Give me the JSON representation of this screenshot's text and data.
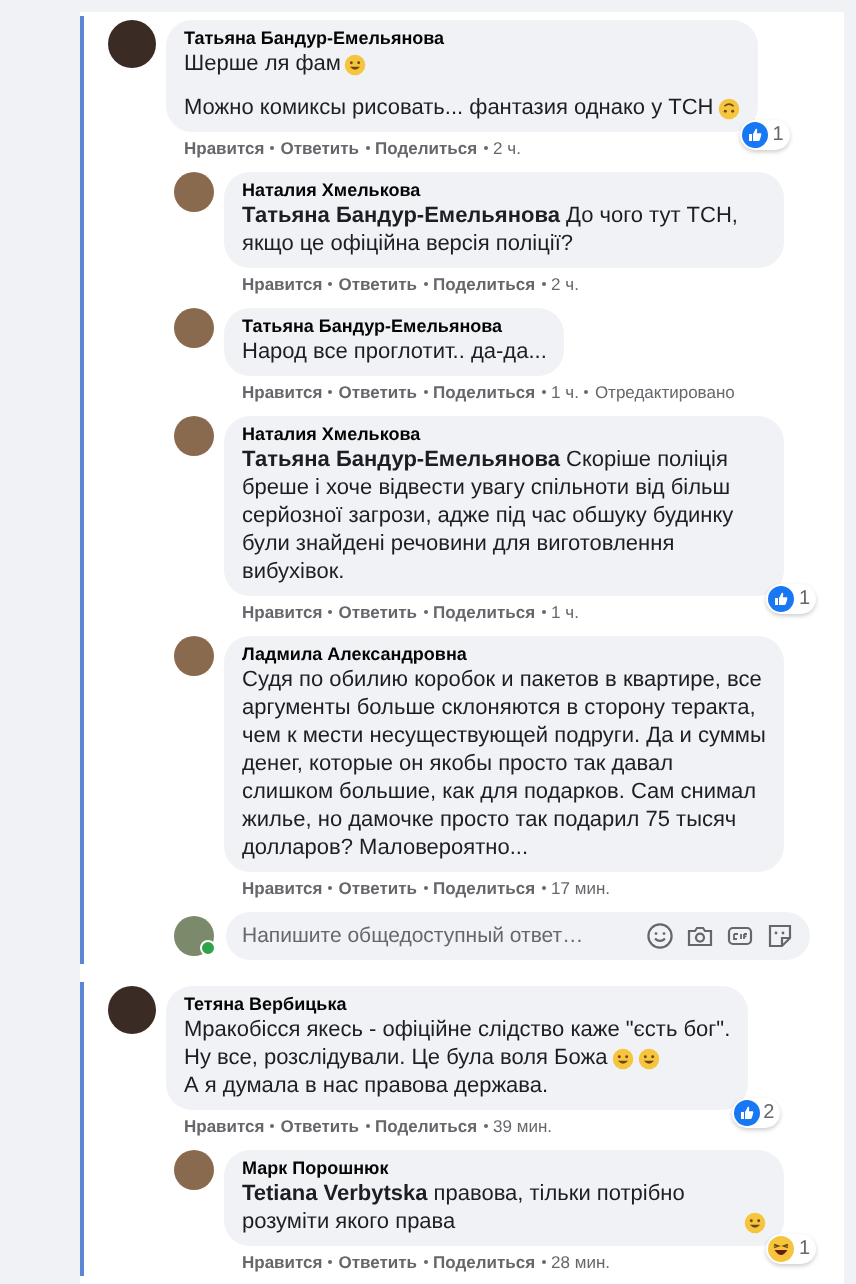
{
  "threads": [
    {
      "author": "Татьяна Бандур-Емельянова",
      "paragraphs": [
        [
          {
            "text": "Шерше ля фам",
            "emojis": [
              {
                "kind": "grin"
              }
            ]
          }
        ],
        [
          {
            "text": "Можно комиксы рисовать... фантазия однако у ТСН",
            "emojis": [
              {
                "kind": "upside-down"
              }
            ]
          }
        ]
      ],
      "reaction": {
        "kind": "like",
        "count": "1"
      },
      "actions": [
        "Нравится",
        "Ответить",
        "Поделиться"
      ],
      "time": "2 ч.",
      "replies": [
        {
          "author": "Наталия Хмелькова",
          "paragraphs": [
            [
              {
                "text": "**Татьяна Бандур-Емельянова** До чого тут ТСН, якщо це офіційна версія поліції?"
              }
            ]
          ],
          "actions": [
            "Нравится",
            "Ответить",
            "Поделиться"
          ],
          "time": "2 ч."
        },
        {
          "author": "Татьяна Бандур-Емельянова",
          "paragraphs": [
            [
              {
                "text": "Народ все проглотит.. да-да..."
              }
            ]
          ],
          "actions": [
            "Нравится",
            "Ответить",
            "Поделиться"
          ],
          "time": "1 ч.",
          "edited": "Отредактировано"
        },
        {
          "author": "Наталия Хмелькова",
          "paragraphs": [
            [
              {
                "text": "**Татьяна Бандур-Емельянова** Скоріше поліція бреше і хоче відвести увагу спільноти від більш серйозної загрози, адже під час обшуку будинку були знайдені речовини для виготовлення вибухівок."
              }
            ]
          ],
          "reaction": {
            "kind": "like",
            "count": "1"
          },
          "actions": [
            "Нравится",
            "Ответить",
            "Поделиться"
          ],
          "time": "1 ч."
        },
        {
          "author": "Ладмила Александровна",
          "paragraphs": [
            [
              {
                "text": "Судя по обилию коробок и пакетов в квартире, все аргументы больше склоняются в сторону теракта, чем к мести несуществующей подруги. Да и суммы денег, которые он якобы просто так давал слишком большие, как для подарков. Сам снимал жилье, но дамочке просто так подарил 75 тысяч долларов? Маловероятно..."
              }
            ]
          ],
          "actions": [
            "Нравится",
            "Ответить",
            "Поделиться"
          ],
          "time": "17 мин."
        }
      ],
      "composer": {
        "placeholder": "Напишите общедоступный ответ…",
        "online": true
      }
    },
    {
      "author": "Тетяна Вербицька",
      "paragraphs": [
        [
          {
            "text": "Мракобісся якесь - офіційне слідство каже \"єсть бог\"."
          },
          {
            "text": "Ну все, розслідували. Це була воля Божа",
            "emojis": [
              {
                "kind": "grin"
              },
              {
                "kind": "grin"
              }
            ]
          },
          {
            "text": "А я думала в нас правова держава."
          }
        ]
      ],
      "reaction": {
        "kind": "like",
        "count": "2"
      },
      "actions": [
        "Нравится",
        "Ответить",
        "Поделиться"
      ],
      "time": "39 мин.",
      "replies": [
        {
          "author": "Марк Порошнюк",
          "paragraphs": [
            [
              {
                "text": "**Tetiana Verbytska** правова, тільки потрібно розуміти якого права",
                "emojis": [
                  {
                    "kind": "grin"
                  }
                ]
              }
            ]
          ],
          "reaction": {
            "kind": "haha",
            "count": "1"
          },
          "actions": [
            "Нравится",
            "Ответить",
            "Поделиться"
          ],
          "time": "28 мин."
        }
      ]
    }
  ]
}
